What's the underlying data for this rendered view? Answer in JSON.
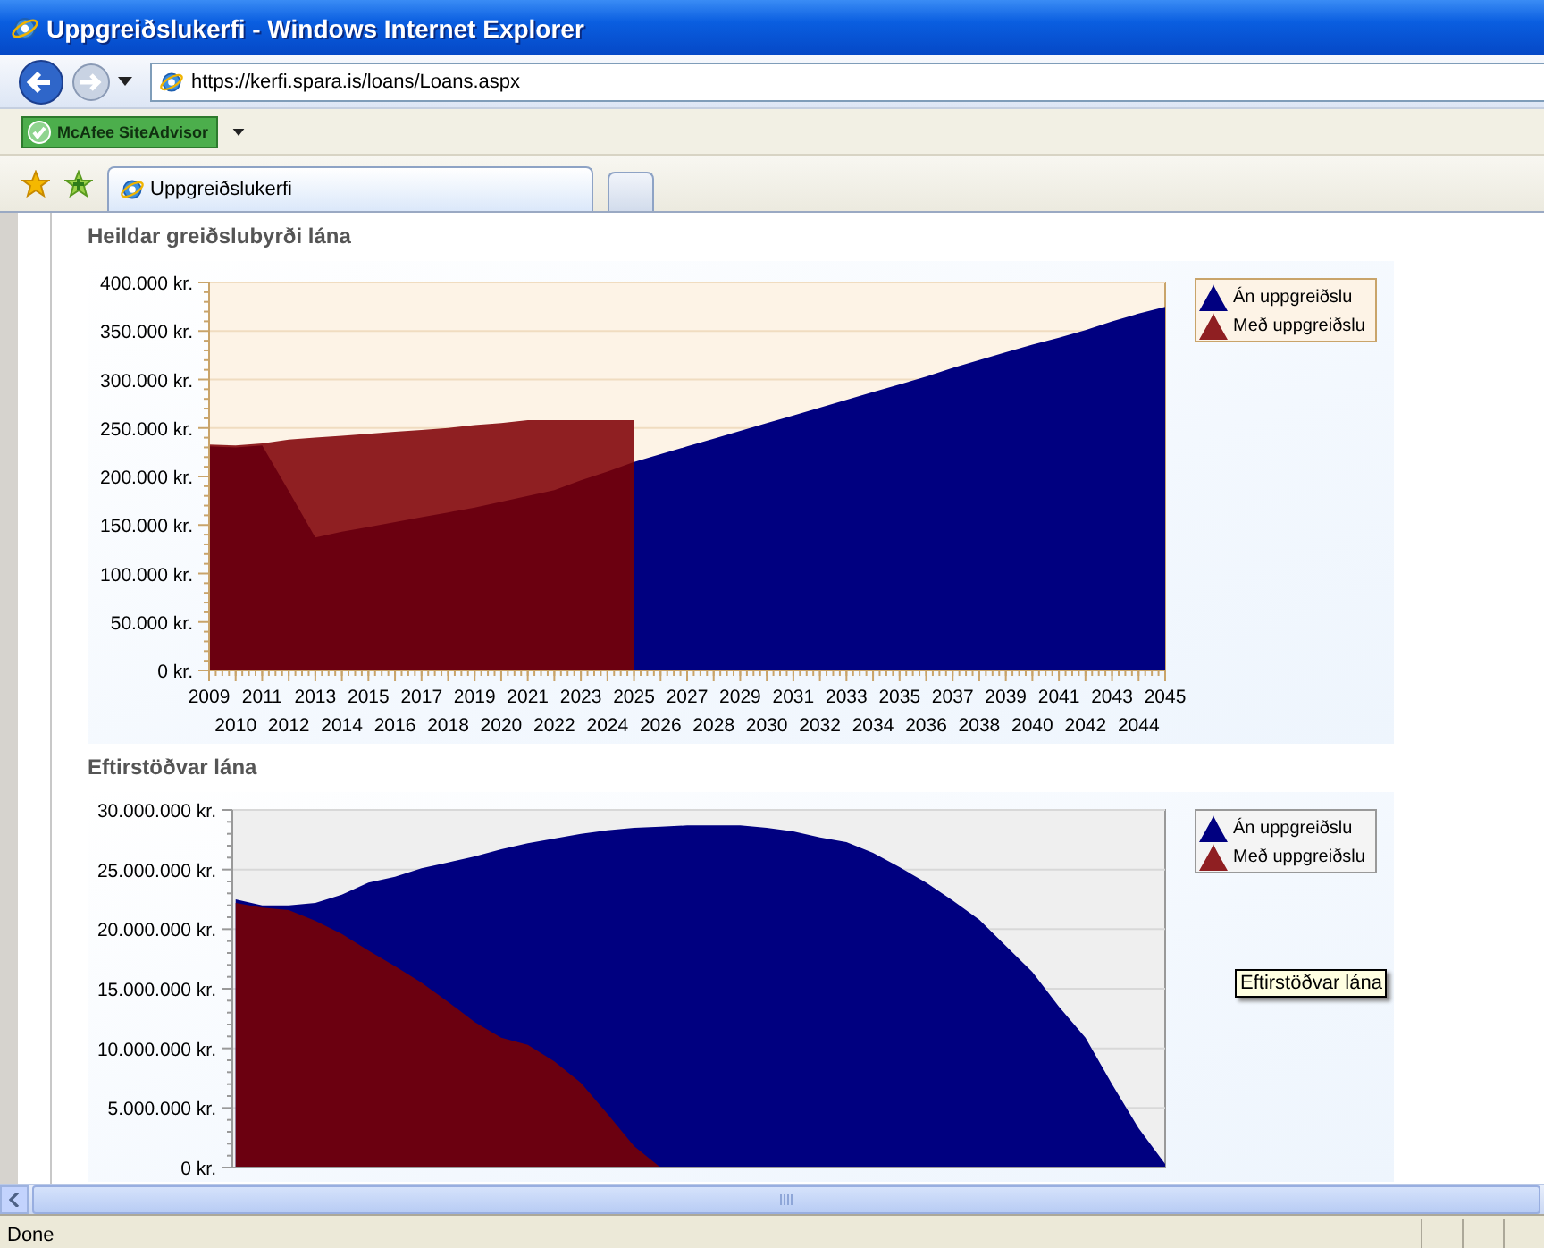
{
  "window": {
    "title": "Uppgreiðslukerfi - Windows Internet Explorer"
  },
  "address_bar": {
    "value": "https://kerfi.spara.is/loans/Loans.aspx"
  },
  "toolbar": {
    "button": "McAfee SiteAdvisor"
  },
  "tabs": [
    {
      "label": "Uppgreiðslukerfi",
      "selected": true
    }
  ],
  "charts": [
    {
      "heading": "Heildar greiðslubyrði lána",
      "chart_data": {
        "type": "area",
        "grid": true,
        "legend": true,
        "x": [
          2009,
          2010,
          2011,
          2012,
          2013,
          2014,
          2015,
          2016,
          2017,
          2018,
          2019,
          2020,
          2021,
          2022,
          2023,
          2024,
          2025,
          2026,
          2027,
          2028,
          2029,
          2030,
          2031,
          2032,
          2033,
          2034,
          2035,
          2036,
          2037,
          2038,
          2039,
          2040,
          2041,
          2042,
          2043,
          2044,
          2045
        ],
        "ylim": [
          0,
          400000
        ],
        "yticks": [
          {
            "value": 0,
            "label": "0 kr."
          },
          {
            "value": 50000,
            "label": "50.000 kr."
          },
          {
            "value": 100000,
            "label": "100.000 kr."
          },
          {
            "value": 150000,
            "label": "150.000 kr."
          },
          {
            "value": 200000,
            "label": "200.000 kr."
          },
          {
            "value": 250000,
            "label": "250.000 kr."
          },
          {
            "value": 300000,
            "label": "300.000 kr."
          },
          {
            "value": 350000,
            "label": "350.000 kr."
          },
          {
            "value": 400000,
            "label": "400.000 kr."
          }
        ],
        "series": [
          {
            "name": "Án uppgreiðslu",
            "color": "#000080",
            "values": [
              231000,
              230000,
              232000,
              185000,
              137000,
              143000,
              148000,
              153000,
              158000,
              163000,
              168000,
              174000,
              180000,
              186000,
              196000,
              205000,
              215000,
              223000,
              231000,
              239000,
              247000,
              255000,
              263000,
              271000,
              279000,
              287000,
              295000,
              303000,
              312000,
              320000,
              328000,
              336000,
              343000,
              351000,
              360000,
              368000,
              375000
            ]
          },
          {
            "name": "Með uppgreiðslu",
            "color": "#8f1f22",
            "values": [
              233000,
              232000,
              234000,
              238000,
              240000,
              242000,
              244000,
              246000,
              248000,
              250000,
              253000,
              255000,
              258000,
              258000,
              258000,
              258000,
              258000,
              null,
              null,
              null,
              null,
              null,
              null,
              null,
              null,
              null,
              null,
              null,
              null,
              null,
              null,
              null,
              null,
              null,
              null,
              null,
              null
            ]
          }
        ]
      }
    },
    {
      "heading": "Eftirstöðvar lána",
      "chart_data": {
        "type": "area",
        "grid": true,
        "legend": true,
        "ylim": [
          0,
          30000000
        ],
        "yticks": [
          {
            "value": 0,
            "label": "0 kr."
          },
          {
            "value": 5000000,
            "label": "5.000.000 kr."
          },
          {
            "value": 10000000,
            "label": "10.000.000 kr."
          },
          {
            "value": 15000000,
            "label": "15.000.000 kr."
          },
          {
            "value": 20000000,
            "label": "20.000.000 kr."
          },
          {
            "value": 25000000,
            "label": "25.000.000 kr."
          },
          {
            "value": 30000000,
            "label": "30.000.000 kr."
          }
        ],
        "series": [
          {
            "name": "Án uppgreiðslu",
            "color": "#000080",
            "values": [
              null,
              22500000,
              22000000,
              22000000,
              22200000,
              22900000,
              23900000,
              24400000,
              25100000,
              25600000,
              26100000,
              26700000,
              27200000,
              27600000,
              28000000,
              28300000,
              28500000,
              28600000,
              28700000,
              28700000,
              28700000,
              28500000,
              28200000,
              27700000,
              27300000,
              26400000,
              25200000,
              23900000,
              22400000,
              20800000,
              18600000,
              16400000,
              13500000,
              10900000,
              7000000,
              3300000,
              300000
            ]
          },
          {
            "name": "Með uppgreiðslu",
            "color": "#8f1f22",
            "values": [
              null,
              22200000,
              21800000,
              21600000,
              20700000,
              19600000,
              18200000,
              16900000,
              15500000,
              13900000,
              12200000,
              10900000,
              10300000,
              8900000,
              7100000,
              4500000,
              1800000,
              0,
              null,
              null,
              null,
              null,
              null,
              null,
              null,
              null,
              null,
              null,
              null,
              null,
              null,
              null,
              null,
              null,
              null,
              null,
              null
            ]
          }
        ]
      }
    }
  ],
  "tooltip": "Eftirstöðvar lána",
  "status_bar": {
    "text": "Done"
  }
}
